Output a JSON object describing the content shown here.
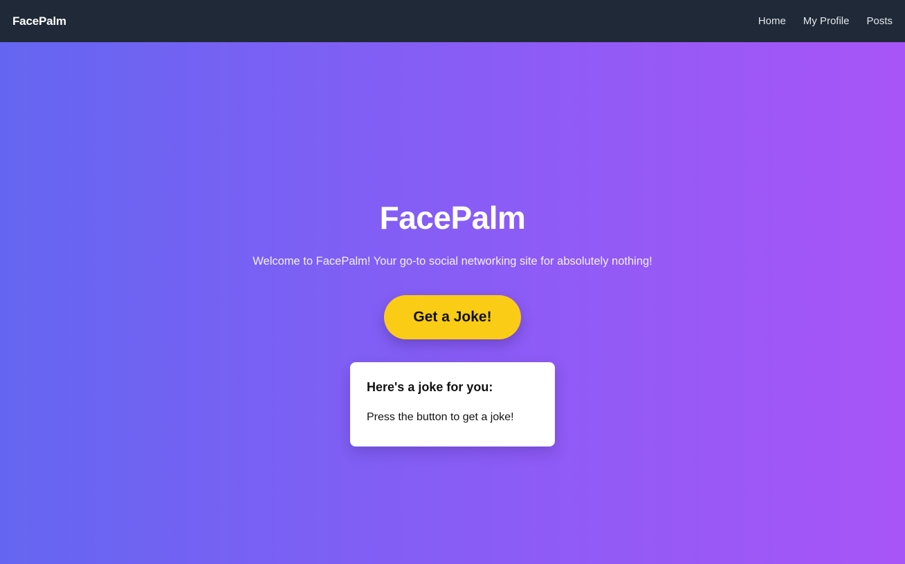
{
  "navbar": {
    "brand": "FacePalm",
    "links": [
      "Home",
      "My Profile",
      "Posts"
    ]
  },
  "hero": {
    "title": "FacePalm",
    "subtitle": "Welcome to FacePalm! Your go-to social networking site for absolutely nothing!",
    "button_label": "Get a Joke!"
  },
  "joke_card": {
    "heading": "Here's a joke for you:",
    "text": "Press the button to get a joke!"
  },
  "colors": {
    "navbar_bg": "#1f2937",
    "gradient_start": "#6466f1",
    "gradient_end": "#a855f7",
    "button_bg": "#facc15",
    "card_bg": "#ffffff"
  }
}
